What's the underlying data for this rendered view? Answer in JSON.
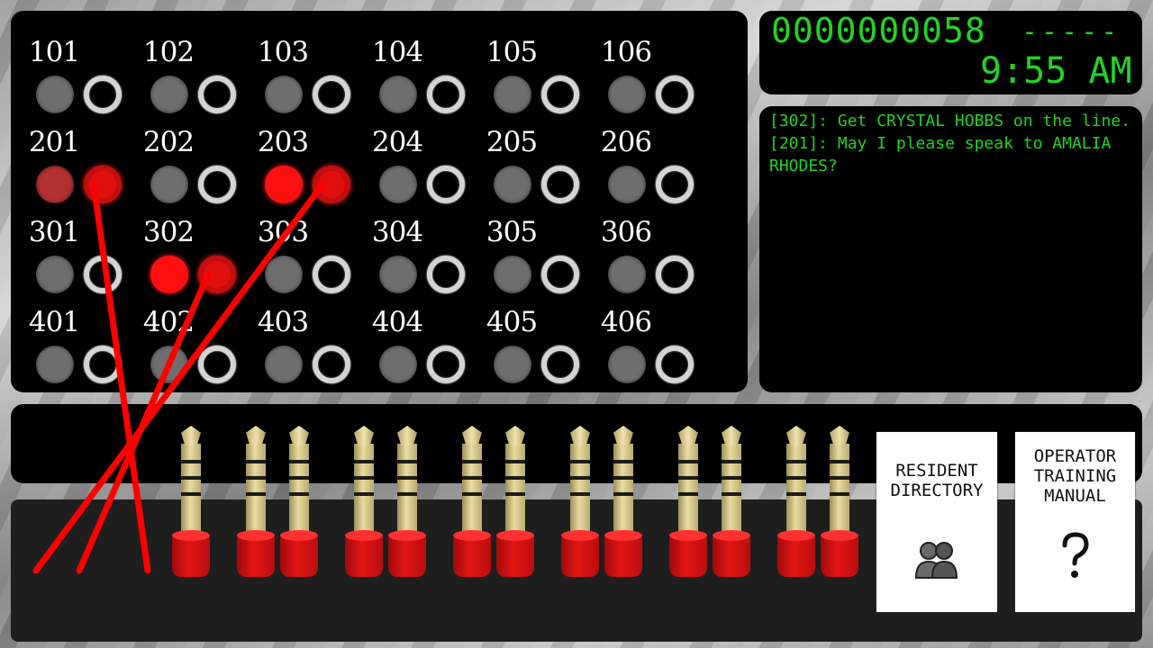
{
  "switchboard": {
    "rows": [
      [
        "101",
        "102",
        "103",
        "104",
        "105",
        "106"
      ],
      [
        "201",
        "202",
        "203",
        "204",
        "205",
        "206"
      ],
      [
        "301",
        "302",
        "303",
        "304",
        "305",
        "306"
      ],
      [
        "401",
        "402",
        "403",
        "404",
        "405",
        "406"
      ]
    ],
    "lamp_states": {
      "201": "dim-red",
      "203": "red",
      "302": "red"
    },
    "plugged_jacks": [
      "201",
      "203",
      "302"
    ]
  },
  "counter": {
    "value": "0000000058",
    "dashes": "-----",
    "clock": "9:55 AM"
  },
  "log": [
    "[302]: Get CRYSTAL HOBBS on the line.",
    "[201]: May I please speak to AMALIA RHODES?"
  ],
  "cards": {
    "directory": {
      "label": "RESIDENT DIRECTORY",
      "icon": "people-icon"
    },
    "manual": {
      "label": "OPERATOR TRAINING MANUAL",
      "icon": "question-icon"
    }
  },
  "cords": [
    {
      "from": "201",
      "to_plug": 2
    },
    {
      "from": "203",
      "to_plug": 0
    },
    {
      "from": "302",
      "to_plug": 1
    }
  ],
  "colors": {
    "terminal_green": "#22d422",
    "cord_red": "#ff0000",
    "plug_gold": "#e9dca0"
  },
  "free_plugs": 13
}
